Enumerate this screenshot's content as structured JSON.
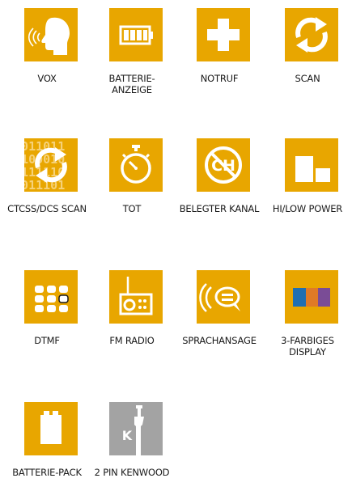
{
  "colors": {
    "tile": "#e8a600",
    "tile_gray": "#a3a3a3",
    "icon": "#ffffff",
    "text": "#1a1a1a"
  },
  "features": [
    {
      "label": "VOX",
      "icon": "speaking-head-icon"
    },
    {
      "label": "BATTERIE-\nANZEIGE",
      "icon": "battery-icon"
    },
    {
      "label": "NOTRUF",
      "icon": "cross-icon"
    },
    {
      "label": "SCAN",
      "icon": "cycle-arrows-icon"
    },
    {
      "label": "CTCSS/DCS SCAN",
      "icon": "binary-cycle-icon",
      "glyph_text": "10011011\n11100010\n10111110\n01011101"
    },
    {
      "label": "TOT",
      "icon": "stopwatch-icon"
    },
    {
      "label": "BELEGTER KANAL",
      "icon": "channel-busy-icon",
      "glyph_text": "CH"
    },
    {
      "label": "HI/LOW POWER",
      "icon": "power-blocks-icon"
    },
    {
      "label": "DTMF",
      "icon": "keypad-icon"
    },
    {
      "label": "FM RADIO",
      "icon": "radio-icon"
    },
    {
      "label": "SPRACHANSAGE",
      "icon": "speech-bubble-icon"
    },
    {
      "label": "3-FARBIGES\nDISPLAY",
      "icon": "color-display-icon",
      "display_colors": [
        "#1f6fb2",
        "#e07a26",
        "#7a4c96"
      ]
    },
    {
      "label": "BATTERIE-PACK",
      "icon": "battery-pack-icon"
    },
    {
      "label": "2 PIN KENWOOD",
      "icon": "kenwood-plug-icon",
      "glyph_text": "K"
    }
  ]
}
